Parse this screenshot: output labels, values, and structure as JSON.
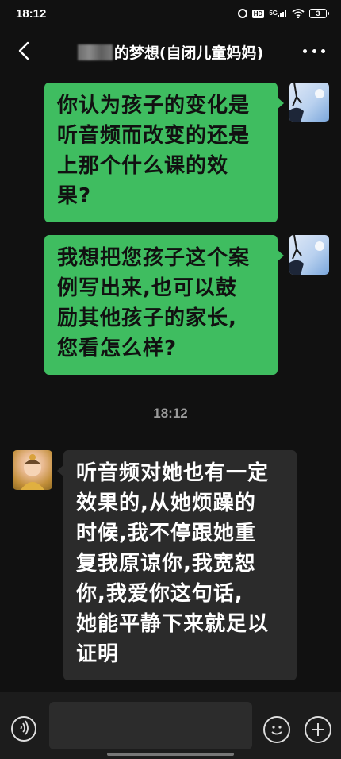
{
  "status_bar": {
    "time": "18:12",
    "hd_label": "HD",
    "network_label": "5G",
    "battery_level": "3",
    "icons": [
      "alarm-icon",
      "hd-icon",
      "signal-icon",
      "wifi-icon",
      "battery-icon"
    ]
  },
  "header": {
    "title": "的梦想(自闭儿童妈妈)",
    "back_icon": "chevron-left-icon",
    "more_icon": "more-dots-icon"
  },
  "messages": [
    {
      "direction": "outgoing",
      "text": "你认为孩子的变化是听音频而改变的还是上那个什么课的效果?",
      "lines": [
        "你认为孩子的变化是",
        "听音频而改变的还是",
        "上那个什么课的效",
        "果?"
      ]
    },
    {
      "direction": "outgoing",
      "text": "我想把您孩子这个案例写出来,也可以鼓励其他孩子的家长,您看怎么样?",
      "lines": [
        "我想把您孩子这个案",
        "例写出来,也可以鼓",
        "励其他孩子的家长,",
        "您看怎么样?"
      ]
    },
    {
      "direction": "incoming",
      "text": "听音频对她也有一定效果的,从她烦躁的时候,我不停跟她重复我原谅你,我宽恕你,我爱你这句话,她能平静下来就足以证明",
      "lines": [
        "听音频对她也有一定",
        "效果的,从她烦躁的",
        "时候,我不停跟她重",
        "复我原谅你,我宽恕",
        "你,我爱你这句话,",
        "她能平静下来就足以",
        "证明"
      ]
    }
  ],
  "timestamp": "18:12",
  "input_bar": {
    "placeholder": "",
    "voice_icon": "voice-icon",
    "emoji_icon": "emoji-icon",
    "plus_icon": "plus-icon"
  },
  "colors": {
    "background": "#111111",
    "outgoing_bubble": "#3fbd60",
    "incoming_bubble": "#2b2b2b"
  }
}
